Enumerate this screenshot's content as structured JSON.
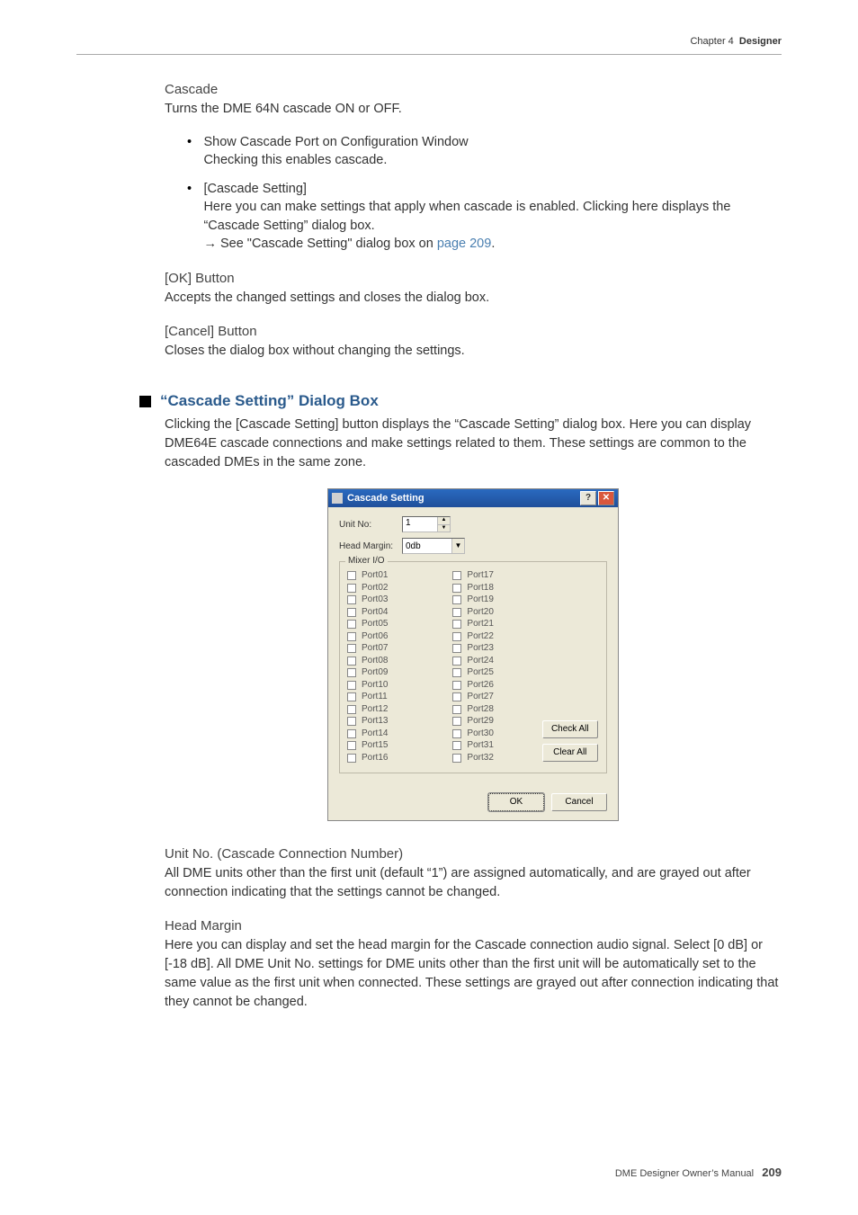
{
  "header": {
    "chapter": "Chapter 4",
    "section": "Designer"
  },
  "cascade": {
    "title": "Cascade",
    "desc": "Turns the DME 64N cascade ON or OFF.",
    "bullet1_title": "Show Cascade Port on Configuration Window",
    "bullet1_body": "Checking this enables cascade.",
    "bullet2_title": "[Cascade Setting]",
    "bullet2_body": "Here you can make settings that apply when cascade is enabled. Clicking here displays the “Cascade Setting” dialog box.",
    "bullet2_ref_pre": "→ See \"Cascade Setting\" dialog box on ",
    "bullet2_ref_link": "page 209",
    "bullet2_ref_post": "."
  },
  "ok": {
    "title": "[OK] Button",
    "desc": "Accepts the changed settings and closes the dialog box."
  },
  "cancel": {
    "title": "[Cancel] Button",
    "desc": "Closes the dialog box without changing the settings."
  },
  "dialog_section": {
    "heading": "“Cascade Setting” Dialog Box",
    "intro": "Clicking the [Cascade Setting] button displays the “Cascade Setting” dialog box. Here you can display DME64E cascade connections and make settings related to them. These settings are common to the cascaded DMEs in the same zone."
  },
  "dialog": {
    "title": "Cascade Setting",
    "unit_no_label": "Unit No:",
    "unit_no_value": "1",
    "head_margin_label": "Head Margin:",
    "head_margin_value": "0db",
    "group_title": "Mixer I/O",
    "ports_left": [
      "Port01",
      "Port02",
      "Port03",
      "Port04",
      "Port05",
      "Port06",
      "Port07",
      "Port08",
      "Port09",
      "Port10",
      "Port11",
      "Port12",
      "Port13",
      "Port14",
      "Port15",
      "Port16"
    ],
    "ports_right": [
      "Port17",
      "Port18",
      "Port19",
      "Port20",
      "Port21",
      "Port22",
      "Port23",
      "Port24",
      "Port25",
      "Port26",
      "Port27",
      "Port28",
      "Port29",
      "Port30",
      "Port31",
      "Port32"
    ],
    "check_all": "Check All",
    "clear_all": "Clear All",
    "ok": "OK",
    "cancel": "Cancel",
    "help_glyph": "?",
    "close_glyph": "✕"
  },
  "unit_no": {
    "title": "Unit No. (Cascade Connection Number)",
    "desc": "All DME units other than the first unit (default “1”) are assigned automatically, and are grayed out after connection indicating that the settings cannot be changed."
  },
  "head_margin": {
    "title": "Head Margin",
    "desc": "Here you can display and set the head margin for the Cascade connection audio signal. Select [0 dB] or [-18 dB]. All DME Unit No. settings for DME units other than the first unit will be automatically set to the same value as the first unit when connected. These settings are grayed out after connection indicating that they cannot be changed."
  },
  "footer": {
    "text": "DME Designer Owner’s Manual",
    "page": "209"
  }
}
